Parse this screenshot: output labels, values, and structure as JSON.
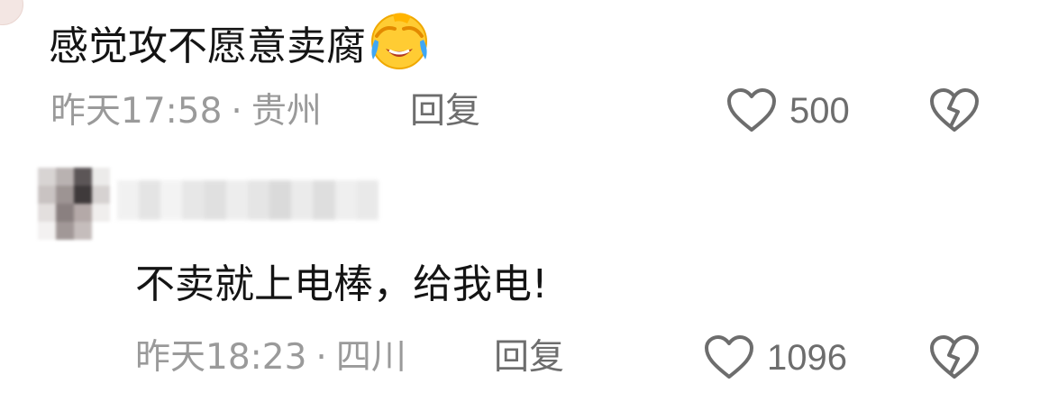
{
  "comments": [
    {
      "text": "感觉攻不愿意卖腐",
      "emoji": "face-with-tears-of-joy",
      "time": "昨天17:58",
      "separator": "·",
      "location": "贵州",
      "reply_label": "回复",
      "like_count": "500"
    },
    {
      "text": "不卖就上电棒，给我电!",
      "time": "昨天18:23",
      "separator": "·",
      "location": "四川",
      "reply_label": "回复",
      "like_count": "1096"
    }
  ],
  "icons": {
    "like": "heart-outline-icon",
    "dislike": "broken-heart-icon"
  },
  "colors": {
    "text_primary": "#141414",
    "text_meta": "#9a9a9a",
    "text_action": "#6d6d6d",
    "icon_stroke": "#6d6d6d"
  }
}
